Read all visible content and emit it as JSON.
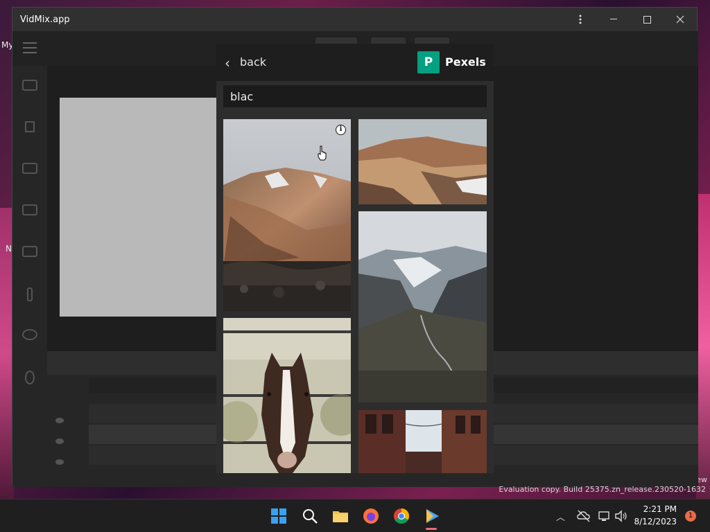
{
  "window": {
    "title": "VidMix.app"
  },
  "desktop": {
    "label_my": "My",
    "label_n": "N",
    "label_ew": "ew",
    "watermark": "Evaluation copy. Build 25375.zn_release.230520-1632"
  },
  "modal": {
    "back_label": "back",
    "brand_name": "Pexels",
    "brand_logo_letter": "P",
    "search_value": "blac",
    "info_glyph": "i"
  },
  "taskbar": {
    "time": "2:21 PM",
    "date": "8/12/2023",
    "notification_count": "1"
  },
  "colors": {
    "pexels_green": "#05a081",
    "window_bg": "#2b2b2b",
    "modal_header": "#1e1e1e"
  }
}
